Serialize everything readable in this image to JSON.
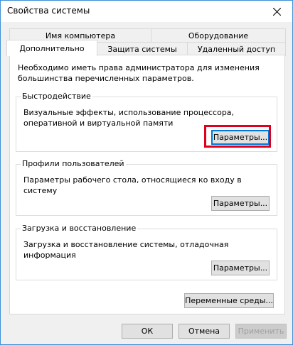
{
  "window": {
    "title": "Свойства системы"
  },
  "tabs_top": [
    {
      "label": "Имя компьютера"
    },
    {
      "label": "Оборудование"
    }
  ],
  "tabs_bottom": [
    {
      "label": "Дополнительно",
      "active": true
    },
    {
      "label": "Защита системы"
    },
    {
      "label": "Удаленный доступ"
    }
  ],
  "advanced": {
    "admin_note": "Необходимо иметь права администратора для изменения большинства перечисленных параметров.",
    "performance": {
      "legend": "Быстродействие",
      "description": "Визуальные эффекты, использование процессора, оперативной и виртуальной памяти",
      "button": "Параметры..."
    },
    "user_profiles": {
      "legend": "Профили пользователей",
      "description": "Параметры рабочего стола, относящиеся ко входу в систему",
      "button": "Параметры..."
    },
    "startup_recovery": {
      "legend": "Загрузка и восстановление",
      "description": "Загрузка и восстановление системы, отладочная информация",
      "button": "Параметры..."
    },
    "env_button": "Переменные среды..."
  },
  "footer": {
    "ok": "ОК",
    "cancel": "Отмена",
    "apply": "Применить"
  },
  "colors": {
    "highlight": "#e0001b",
    "focus": "#0078d7",
    "window_border": "#3c8fd6"
  }
}
